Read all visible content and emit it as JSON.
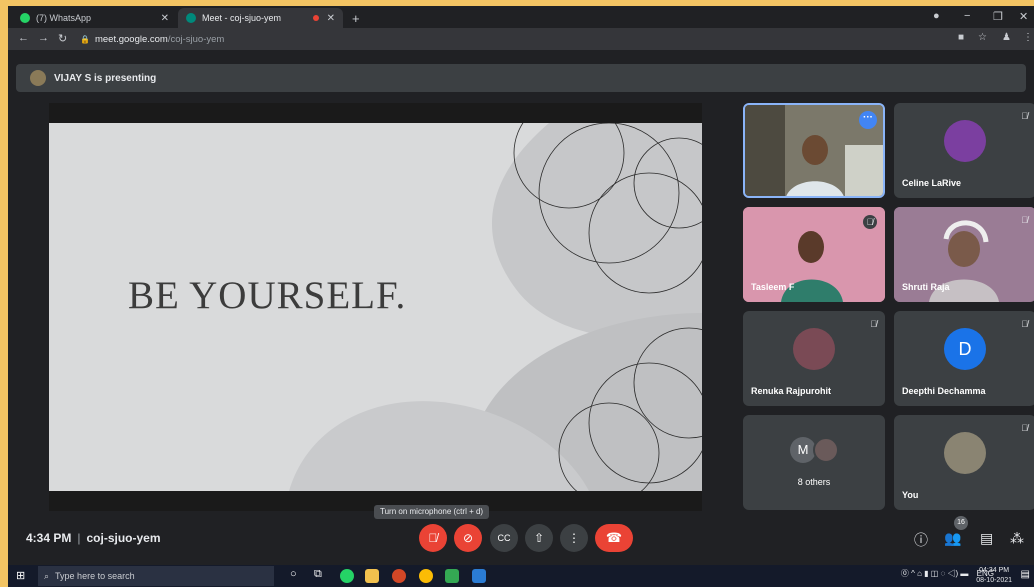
{
  "browser": {
    "tabs": [
      {
        "label": "(7) WhatsApp",
        "active": false
      },
      {
        "label": "Meet - coj-sjuo-yem",
        "active": true
      }
    ],
    "new_tab": "+",
    "url_host": "meet.google.com",
    "url_path": "/coj-sjuo-yem"
  },
  "meet": {
    "presenting_text": "VIJAY S is presenting",
    "slide_text": "BE YOURSELF.",
    "participants": [
      {
        "name": "",
        "muted": false
      },
      {
        "name": "Celine LaRive",
        "muted": true
      },
      {
        "name": "Tasleem F",
        "muted": true
      },
      {
        "name": "Shruti Raja",
        "muted": true
      },
      {
        "name": "Renuka Rajpurohit",
        "muted": true
      },
      {
        "name": "Deepthi Dechamma",
        "muted": false,
        "initial": "D"
      },
      {
        "name": "8 others",
        "initial": "M"
      },
      {
        "name": "You",
        "muted": true
      }
    ],
    "time": "4:34 PM",
    "meeting_code": "coj-sjuo-yem",
    "tooltip": "Turn on microphone (ctrl + d)",
    "people_count": "16"
  },
  "taskbar": {
    "search_placeholder": "Type here to search",
    "lang": "ENG",
    "clock_time": "04:34 PM",
    "clock_date": "08-10-2021"
  },
  "colors": {
    "accent_blue": "#8ab4f8",
    "danger_red": "#ea4335",
    "avatar_blue": "#1a73e8"
  }
}
